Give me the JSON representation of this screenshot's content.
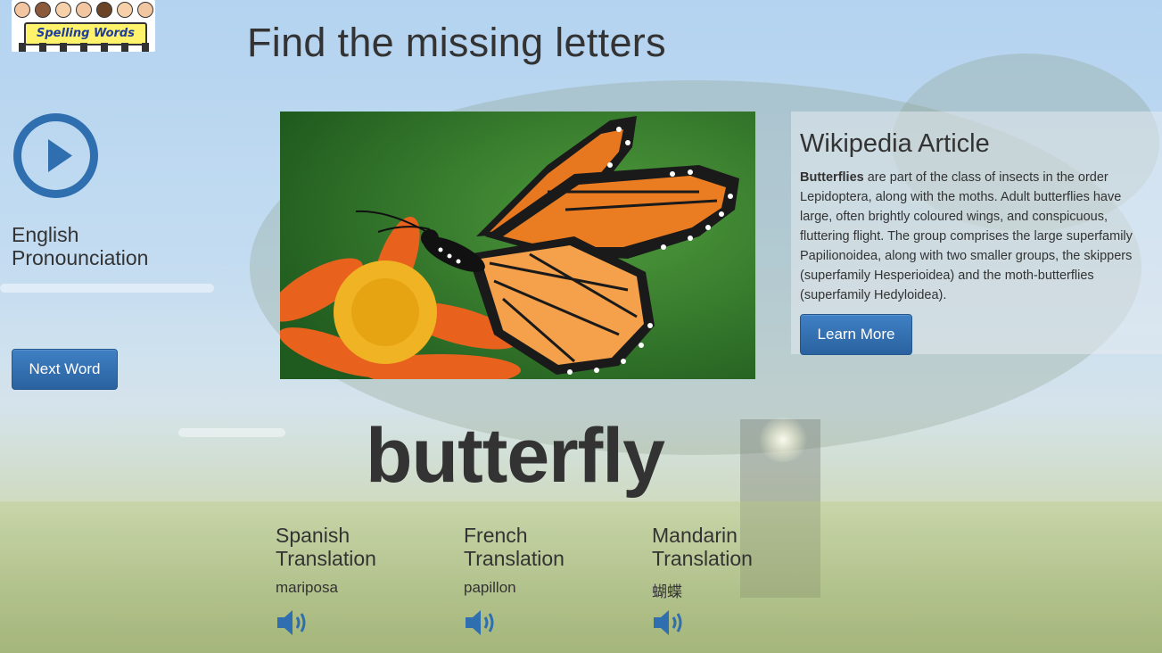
{
  "logo": {
    "text": "Spelling Words"
  },
  "page_title": "Find the missing letters",
  "pronunciation": {
    "label": "English Pronounciation",
    "icon": "play-icon"
  },
  "buttons": {
    "next_word": "Next Word",
    "learn_more": "Learn More"
  },
  "wikipedia": {
    "heading": "Wikipedia Article",
    "bold_term": "Butterflies",
    "body": " are part of the class of insects in the order Lepidoptera, along with the moths. Adult butterflies have large, often brightly coloured wings, and conspicuous, fluttering flight. The group comprises the large superfamily Papilionoidea, along with two smaller groups, the skippers (superfamily Hesperioidea) and the moth-butterflies (superfamily Hedyloidea)."
  },
  "word": "butterfly",
  "translations": [
    {
      "label": "Spanish Translation",
      "value": "mariposa",
      "icon": "speaker-icon"
    },
    {
      "label": "French Translation",
      "value": "papillon",
      "icon": "speaker-icon"
    },
    {
      "label": "Mandarin Translation",
      "value": "蝴蝶",
      "icon": "speaker-icon"
    }
  ],
  "colors": {
    "accent": "#2f6faf",
    "button_top": "#3f80c4",
    "button_bottom": "#2a629f",
    "text": "#333333"
  }
}
